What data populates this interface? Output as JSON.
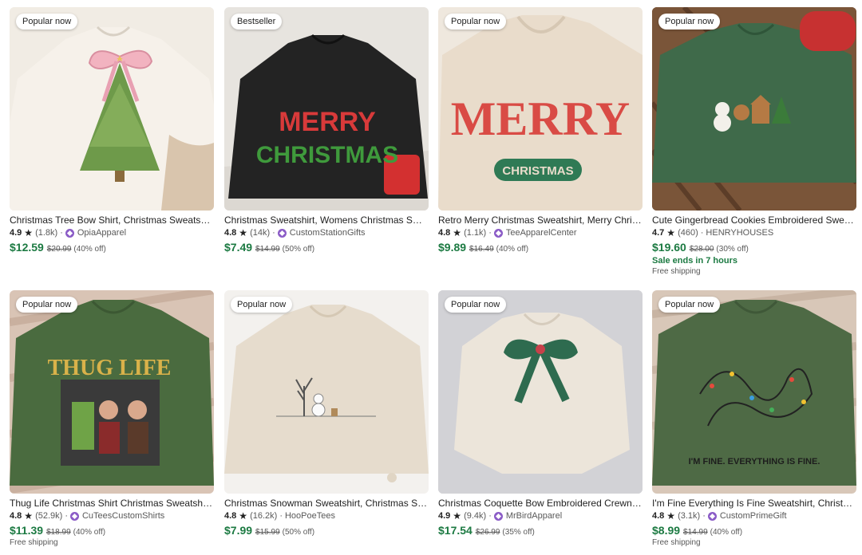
{
  "products": [
    {
      "badge": "Popular now",
      "title": "Christmas Tree Bow Shirt, Christmas Sweatshirt, Christmas Tree Coquette Sweater",
      "rating": "4.9",
      "reviews": "(1.8k)",
      "seller": "OpiaApparel",
      "price": "$12.59",
      "original_price": "$20.99",
      "discount": "(40% off)",
      "sale_text": "",
      "shipping": ""
    },
    {
      "badge": "Bestseller",
      "title": "Christmas Sweatshirt, Womens Christmas Sweater, Merry Christmas Shirt",
      "rating": "4.8",
      "reviews": "(14k)",
      "seller": "CustomStationGifts",
      "price": "$7.49",
      "original_price": "$14.99",
      "discount": "(50% off)",
      "sale_text": "",
      "shipping": ""
    },
    {
      "badge": "Popular now",
      "title": "Retro Merry Christmas Sweatshirt, Merry Christmas Crewneck, Holiday Sweater",
      "rating": "4.8",
      "reviews": "(1.1k)",
      "seller": "TeeApparelCenter",
      "price": "$9.89",
      "original_price": "$16.49",
      "discount": "(40% off)",
      "sale_text": "",
      "shipping": ""
    },
    {
      "badge": "Popular now",
      "title": "Cute Gingerbread Cookies Embroidered Sweatshirt, Christmas Cookies Sweater",
      "rating": "4.7",
      "reviews": "(460)",
      "seller": "HENRYHOUSES",
      "price": "$19.60",
      "original_price": "$28.00",
      "discount": "(30% off)",
      "sale_text": "Sale ends in 7 hours",
      "shipping": "Free shipping"
    },
    {
      "badge": "Popular now",
      "title": "Thug Life Christmas Shirt Christmas Sweatshirt, Funny Christmas Movie Shirt",
      "rating": "4.8",
      "reviews": "(52.9k)",
      "seller": "CuTeesCustomShirts",
      "price": "$11.39",
      "original_price": "$18.99",
      "discount": "(40% off)",
      "sale_text": "",
      "shipping": "Free shipping"
    },
    {
      "badge": "Popular now",
      "title": "Christmas Snowman Sweatshirt, Christmas Sweater, Winter Snowman Crewneck",
      "rating": "4.8",
      "reviews": "(16.2k)",
      "seller": "HooPoeTees",
      "price": "$7.99",
      "original_price": "$15.99",
      "discount": "(50% off)",
      "sale_text": "",
      "shipping": ""
    },
    {
      "badge": "Popular now",
      "title": "Christmas Coquette Bow Embroidered Crewneck Sweatshirt, Holiday Bow Sweater",
      "rating": "4.9",
      "reviews": "(9.4k)",
      "seller": "MrBirdApparel",
      "price": "$17.54",
      "original_price": "$26.99",
      "discount": "(35% off)",
      "sale_text": "",
      "shipping": ""
    },
    {
      "badge": "Popular now",
      "title": "I'm Fine Everything Is Fine Sweatshirt, Christmas Lights Sweatshirt",
      "rating": "4.8",
      "reviews": "(3.1k)",
      "seller": "CustomPrimeGift",
      "price": "$8.99",
      "original_price": "$14.99",
      "discount": "(40% off)",
      "sale_text": "",
      "shipping": "Free shipping"
    }
  ],
  "image_text": {
    "merry_a": "MERRY",
    "christmas_a": "CHRISTMAS",
    "merry_b": "MERRY",
    "christmas_b": "CHRISTMAS",
    "thug_life": "THUG LIFE",
    "fine": "I'M FINE. EVERYTHING IS FINE."
  },
  "colors": {
    "price_green": "#1c7a42",
    "seller_badge": "#8b5cc7"
  }
}
